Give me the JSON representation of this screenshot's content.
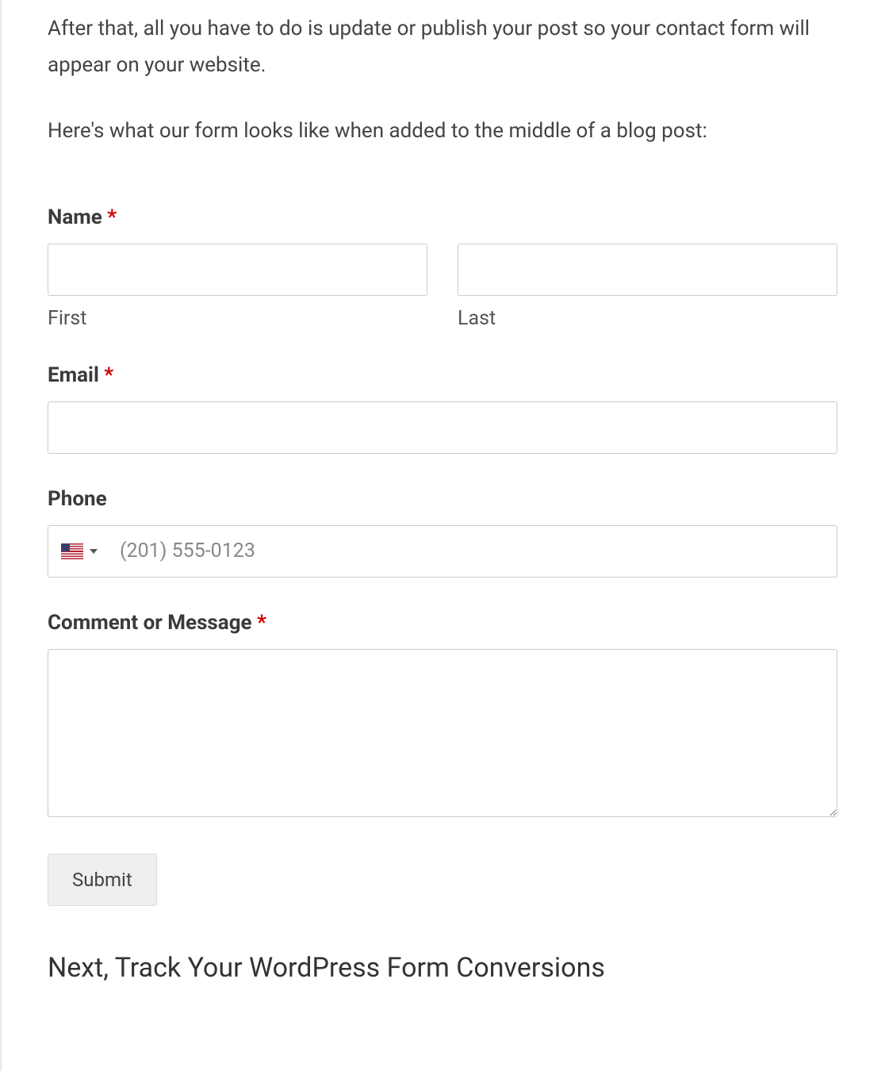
{
  "paragraphs": {
    "p1": "After that, all you have to do is update or publish your post so your contact form will appear on your website.",
    "p2": "Here's what our form looks like when added to the middle of a blog post:"
  },
  "form": {
    "name": {
      "label": "Name",
      "required_mark": "*",
      "first_sub": "First",
      "last_sub": "Last"
    },
    "email": {
      "label": "Email",
      "required_mark": "*"
    },
    "phone": {
      "label": "Phone",
      "placeholder": "(201) 555-0123",
      "country": "us"
    },
    "comment": {
      "label": "Comment or Message",
      "required_mark": "*"
    },
    "submit_label": "Submit"
  },
  "next_heading": "Next, Track Your WordPress Form Conversions"
}
